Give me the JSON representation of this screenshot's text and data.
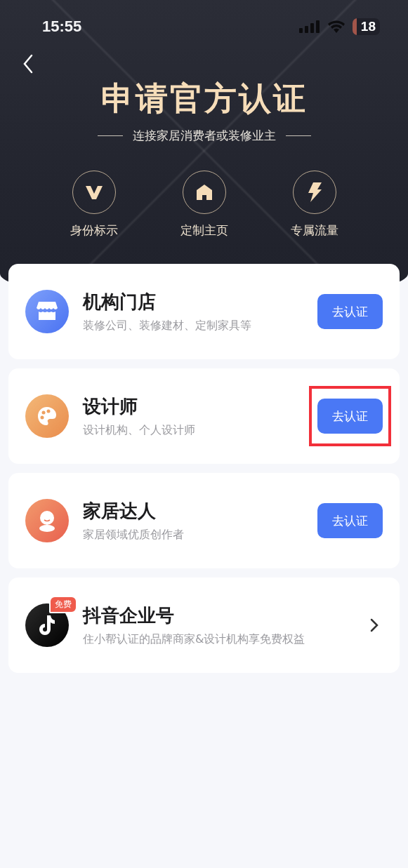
{
  "status_bar": {
    "time": "15:55",
    "battery": "18"
  },
  "header": {
    "title": "申请官方认证",
    "subtitle": "连接家居消费者或装修业主",
    "features": [
      {
        "kind": "badge",
        "label": "身份标示"
      },
      {
        "kind": "home",
        "label": "定制主页"
      },
      {
        "kind": "bolt",
        "label": "专属流量"
      }
    ]
  },
  "items": [
    {
      "kind": "button",
      "title": "机构门店",
      "description": "装修公司、装修建材、定制家具等",
      "action": "去认证",
      "highlighted": false
    },
    {
      "kind": "button",
      "title": "设计师",
      "description": "设计机构、个人设计师",
      "action": "去认证",
      "highlighted": true
    },
    {
      "kind": "button",
      "title": "家居达人",
      "description": "家居领域优质创作者",
      "action": "去认证",
      "highlighted": false
    },
    {
      "kind": "link",
      "badge": "免费",
      "title": "抖音企业号",
      "description": "住小帮认证的品牌商家&设计机构享免费权益"
    }
  ]
}
